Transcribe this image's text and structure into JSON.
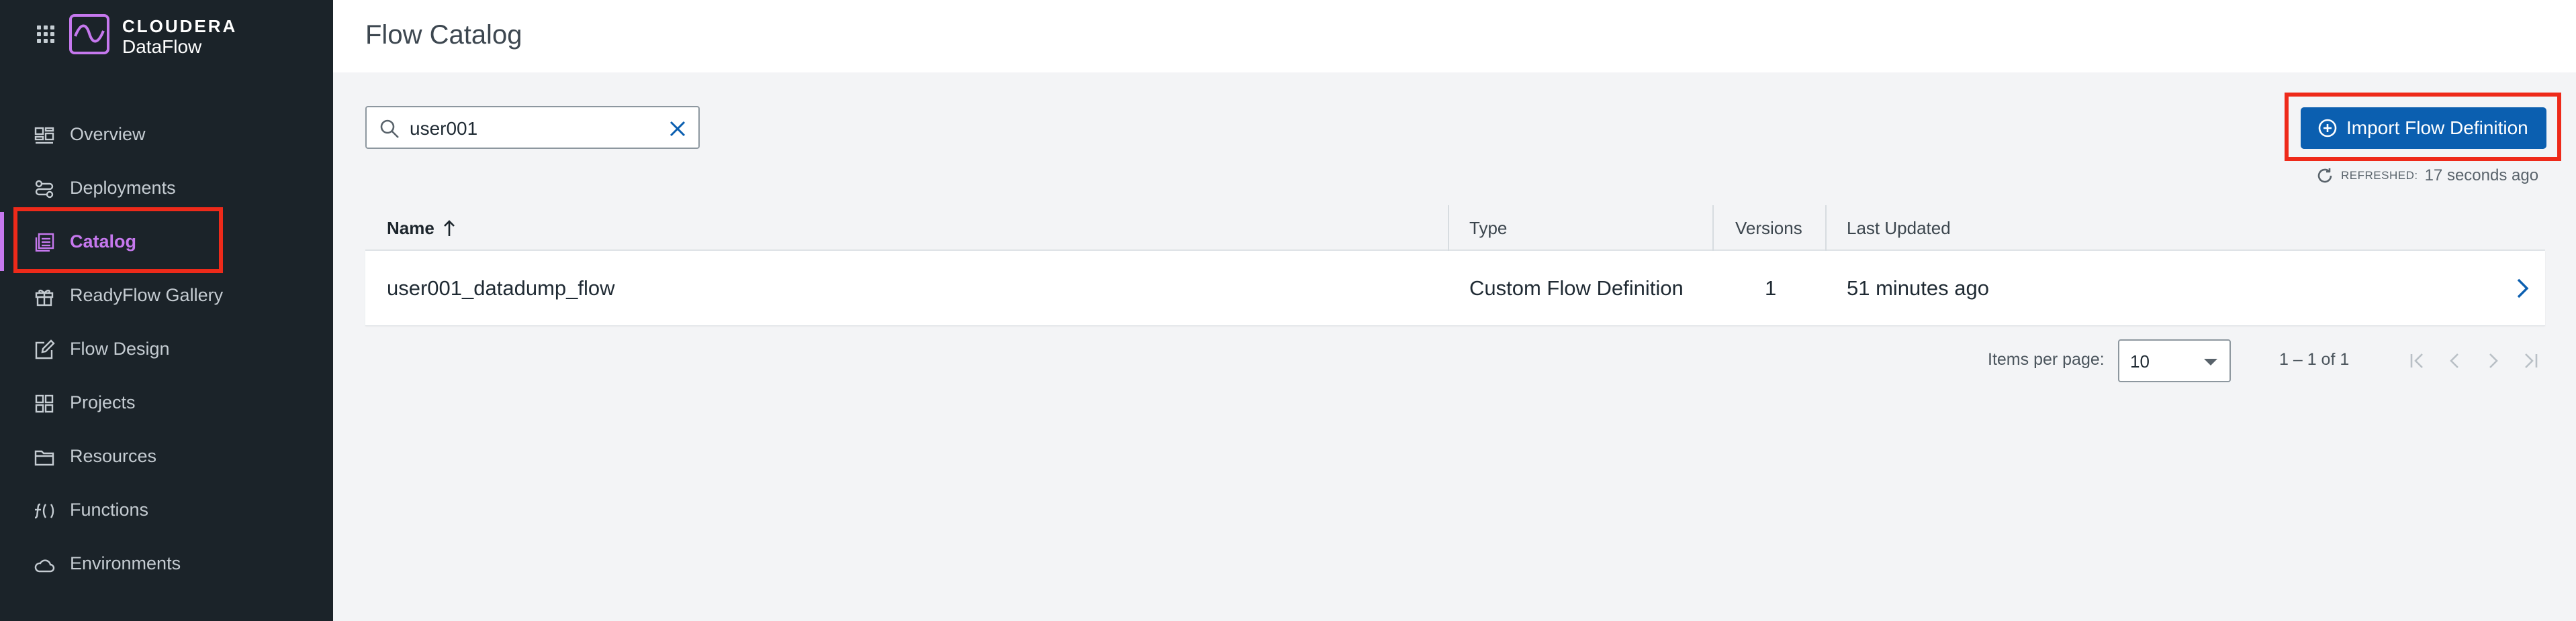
{
  "brand": {
    "name_top": "CLOUDERA",
    "name_bottom": "DataFlow",
    "accent": "#c678ee"
  },
  "sidebar": {
    "items": [
      {
        "label": "Overview",
        "icon": "overview-icon"
      },
      {
        "label": "Deployments",
        "icon": "deployments-icon"
      },
      {
        "label": "Catalog",
        "icon": "catalog-icon",
        "active": true
      },
      {
        "label": "ReadyFlow Gallery",
        "icon": "gift-icon"
      },
      {
        "label": "Flow Design",
        "icon": "edit-icon"
      },
      {
        "label": "Projects",
        "icon": "projects-icon"
      },
      {
        "label": "Resources",
        "icon": "folder-icon"
      },
      {
        "label": "Functions",
        "icon": "function-icon"
      },
      {
        "label": "Environments",
        "icon": "cloud-icon"
      }
    ]
  },
  "header": {
    "title": "Flow Catalog"
  },
  "search": {
    "value": "user001"
  },
  "actions": {
    "import_label": "Import Flow Definition",
    "button_color": "#0b5fb0"
  },
  "refresh": {
    "label": "REFRESHED:",
    "time": "17 seconds ago"
  },
  "table": {
    "columns": [
      "Name",
      "Type",
      "Versions",
      "Last Updated"
    ],
    "rows": [
      {
        "name": "user001_datadump_flow",
        "type": "Custom Flow Definition",
        "versions": "1",
        "updated": "51 minutes ago"
      }
    ]
  },
  "pagination": {
    "items_label": "Items per page:",
    "per_page": "10",
    "range": "1 – 1 of 1"
  },
  "highlight_color": "#ee2a1a"
}
